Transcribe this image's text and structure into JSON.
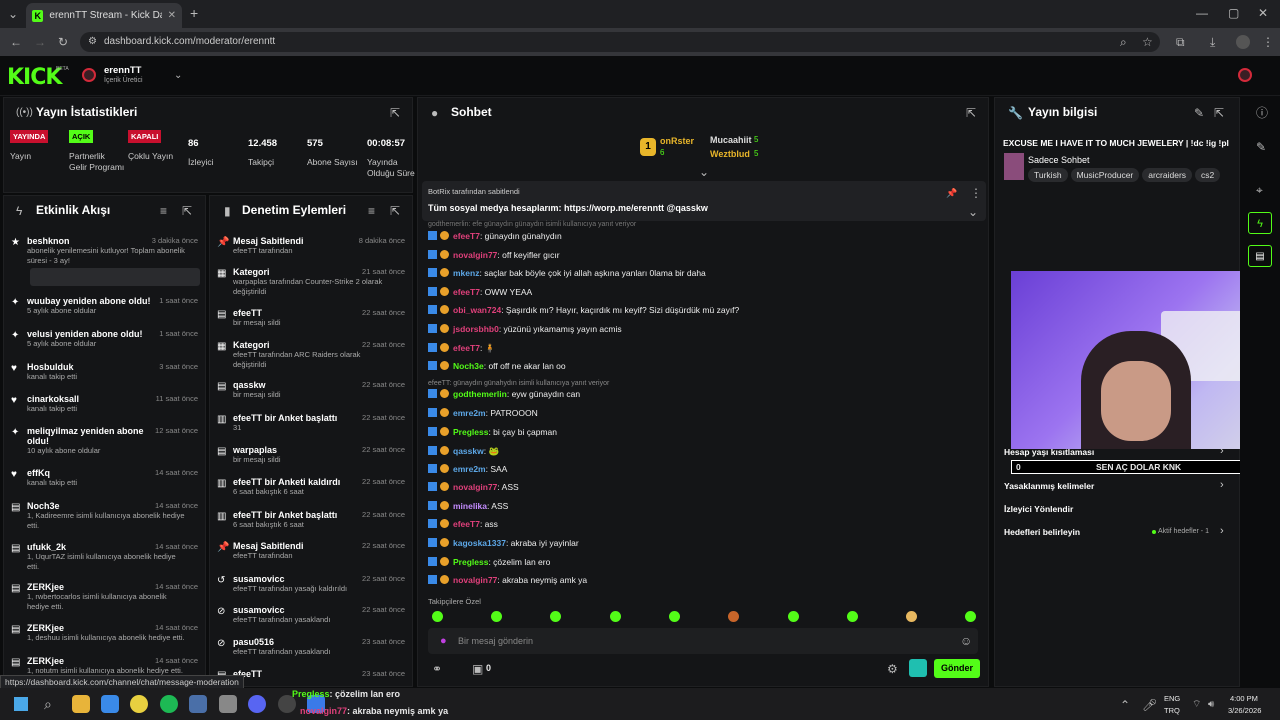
{
  "browser": {
    "tab_title": "erennTT Stream - Kick Dashboard",
    "url": "dashboard.kick.com/moderator/erenntt"
  },
  "header": {
    "logo": "KICK",
    "beta": "BETA",
    "channel": "erennTT",
    "role": "İçerik Üretici"
  },
  "stats": {
    "title": "Yayın İstatistikleri",
    "items": [
      {
        "badge": "YAYINDA",
        "label": "Yayın",
        "kind": "red"
      },
      {
        "badge": "AÇIK",
        "label": "Partnerlik Gelir Programı",
        "kind": "green"
      },
      {
        "badge": "KAPALI",
        "label": "Çoklu Yayın",
        "kind": "red"
      },
      {
        "value": "86",
        "label": "İzleyici"
      },
      {
        "value": "12.458",
        "label": "Takipçi"
      },
      {
        "value": "575",
        "label": "Abone Sayısı"
      },
      {
        "value": "00:08:57",
        "label": "Yayında Olduğu Süre"
      }
    ]
  },
  "activity": {
    "title": "Etkinlik Akışı",
    "items": [
      {
        "icon": "★",
        "name": "beshknon",
        "time": "3 dakika önce",
        "sub": "abonelik yenilemesini kutluyor! Toplam abonelik süresi - 3 ay!"
      },
      {
        "icon": "✦",
        "name": "wuubay yeniden abone oldu!",
        "time": "1 saat önce",
        "sub": "5 aylık abone oldular"
      },
      {
        "icon": "✦",
        "name": "velusi yeniden abone oldu!",
        "time": "1 saat önce",
        "sub": "5 aylık abone oldular"
      },
      {
        "icon": "♥",
        "name": "Hosbulduk",
        "time": "3 saat önce",
        "sub": "kanalı takip etti"
      },
      {
        "icon": "♥",
        "name": "cinarkoksall",
        "time": "11 saat önce",
        "sub": "kanalı takip etti"
      },
      {
        "icon": "✦",
        "name": "meliqyilmaz yeniden abone oldu!",
        "time": "12 saat önce",
        "sub": "10 aylık abone oldular"
      },
      {
        "icon": "♥",
        "name": "effKq",
        "time": "14 saat önce",
        "sub": "kanalı takip etti"
      },
      {
        "icon": "▤",
        "name": "Noch3e",
        "time": "14 saat önce",
        "sub": "1, Kadireemre isimli kullanıcıya abonelik hediye etti."
      },
      {
        "icon": "▤",
        "name": "ufukk_2k",
        "time": "14 saat önce",
        "sub": "1, UqurTAZ isimli kullanıcıya abonelik hediye etti."
      },
      {
        "icon": "▤",
        "name": "ZERKjee",
        "time": "14 saat önce",
        "sub": "1, rwbertocarlos isimli kullanıcıya abonelik hediye etti."
      },
      {
        "icon": "▤",
        "name": "ZERKjee",
        "time": "14 saat önce",
        "sub": "1, deshuu isimli kullanıcıya abonelik hediye etti."
      },
      {
        "icon": "▤",
        "name": "ZERKjee",
        "time": "14 saat önce",
        "sub": "1, notutm isimli kullanıcıya abonelik hediye etti."
      }
    ]
  },
  "mod": {
    "title": "Denetim Eylemleri",
    "items": [
      {
        "icon": "📌",
        "name": "Mesaj Sabitlendi",
        "time": "8 dakika önce",
        "sub": "efeeTT tarafından"
      },
      {
        "icon": "▦",
        "name": "Kategori",
        "time": "21 saat önce",
        "sub": "warpaplas tarafından Counter-Strike 2 olarak değiştirildi"
      },
      {
        "icon": "▤",
        "name": "efeeTT",
        "time": "22 saat önce",
        "sub": "bir mesajı sildi"
      },
      {
        "icon": "▦",
        "name": "Kategori",
        "time": "22 saat önce",
        "sub": "efeeTT tarafından ARC Raiders olarak değiştirildi"
      },
      {
        "icon": "▤",
        "name": "qasskw",
        "time": "22 saat önce",
        "sub": "bir mesajı sildi"
      },
      {
        "icon": "▥",
        "name": "efeeTT bir Anket başlattı",
        "time": "22 saat önce",
        "sub": "31"
      },
      {
        "icon": "▤",
        "name": "warpaplas",
        "time": "22 saat önce",
        "sub": "bir mesajı sildi"
      },
      {
        "icon": "▥",
        "name": "efeeTT bir Anketi kaldırdı",
        "time": "22 saat önce",
        "sub": "6 saat bakıştık 6 saat"
      },
      {
        "icon": "▥",
        "name": "efeeTT bir Anket başlattı",
        "time": "22 saat önce",
        "sub": "6 saat bakıştık 6 saat"
      },
      {
        "icon": "📌",
        "name": "Mesaj Sabitlendi",
        "time": "22 saat önce",
        "sub": "efeeTT tarafından"
      },
      {
        "icon": "↺",
        "name": "susamovicc",
        "time": "22 saat önce",
        "sub": "efeeTT tarafından yasağı kaldırıldı"
      },
      {
        "icon": "⊘",
        "name": "susamovicc",
        "time": "22 saat önce",
        "sub": "efeeTT tarafından yasaklandı"
      },
      {
        "icon": "⊘",
        "name": "pasu0516",
        "time": "23 saat önce",
        "sub": "efeeTT tarafından yasaklandı"
      },
      {
        "icon": "▤",
        "name": "efeeTT",
        "time": "23 saat önce",
        "sub": ""
      }
    ]
  },
  "chat": {
    "title": "Sohbet",
    "top1": {
      "name": "onRster",
      "count": "6"
    },
    "top2": {
      "name": "Mucaahiit",
      "count": "5"
    },
    "top3": {
      "name": "Weztblud",
      "count": "5"
    },
    "pinned_by": "BotRix tarafından sabitlendi",
    "pinned_text": "Tüm sosyal medya hesaplarım: https://worp.me/erenntt @qasskw",
    "reply_hint": "godthemerlin: efe günaydın günaydın isimli kullanıcıya yanıt veriyor",
    "messages": [
      {
        "user": "efeeT7",
        "color": "#e0407b",
        "text": ": günaydın günahydın"
      },
      {
        "user": "novalgin77",
        "color": "#e0407b",
        "text": ": off keyifler gıcır"
      },
      {
        "user": "mkenz",
        "color": "#5da8e8",
        "text": ": saçlar bak böyle çok iyi allah aşkına yanları 0lama bir daha"
      },
      {
        "user": "efeeT7",
        "color": "#e0407b",
        "text": ": OWW YEAA"
      },
      {
        "user": "obi_wan724",
        "color": "#e0407b",
        "text": ": Şaşırdık mı? Hayır, kaçırdık mı keyif? Sizi düşürdük mü zayıf?"
      },
      {
        "user": "jsdorsbhb0",
        "color": "#e0407b",
        "text": ": yüzünü yıkamamış yayın acmis"
      },
      {
        "user": "efeeT7",
        "color": "#e0407b",
        "text": ": 🧍"
      },
      {
        "user": "Noch3e",
        "color": "#53fc18",
        "text": ": off off ne akar lan oo"
      },
      {
        "user": "godthemerlin",
        "color": "#53fc18",
        "text": ": eyw günaydın can"
      },
      {
        "user": "emre2m",
        "color": "#5da8e8",
        "text": ": PATROOON"
      },
      {
        "user": "Pregless",
        "color": "#53fc18",
        "text": ": bi çay bi çapman"
      },
      {
        "user": "qasskw",
        "color": "#5da8e8",
        "text": ": 🐸"
      },
      {
        "user": "emre2m",
        "color": "#5da8e8",
        "text": ": SAA"
      },
      {
        "user": "novalgin77",
        "color": "#e0407b",
        "text": ": ASS"
      },
      {
        "user": "minelika",
        "color": "#c48cff",
        "text": ": ASS"
      },
      {
        "user": "efeeT7",
        "color": "#e0407b",
        "text": ": ass"
      },
      {
        "user": "kagoska1337",
        "color": "#5da8e8",
        "text": ": akraba iyi yayinlar"
      },
      {
        "user": "Pregless",
        "color": "#53fc18",
        "text": ": çözelim lan ero"
      },
      {
        "user": "novalgin77",
        "color": "#e0407b",
        "text": ": akraba neymiş amk ya"
      }
    ],
    "reply_hint2": "efeeTT: günaydın günahydın isimli kullanıcıya yanıt veriyor",
    "followers_only": "Takipçilere Özel",
    "input_placeholder": "Bir mesaj gönderin",
    "send": "Gönder",
    "count0": "0"
  },
  "info": {
    "title": "Yayın bilgisi",
    "stream_title": "EXCUSE ME I HAVE IT TO MUCH JEWELERY | !dc !ig !pl",
    "category": "Sadece Sohbet",
    "tags": [
      "Turkish",
      "MusicProducer",
      "arcraiders",
      "cs2"
    ],
    "rows": [
      "Hesap yaşı kısıtlaması",
      "Yasaklanmış kelimeler",
      "İzleyici Yönlendir",
      "Hedefleri belirleyin"
    ],
    "goal_badge": "Aktif hedefler - 1",
    "goal_title": "SEN AÇ DOLAR KNK",
    "goal_min": "0",
    "goal_max": "10"
  },
  "status_url": "https://dashboard.kick.com/channel/chat/message-moderation",
  "overlay": {
    "line1_user": "Pregless",
    "line1_text": ": çözelim lan ero",
    "line2_user": "novalgin77",
    "line2_text": ": akraba neymiş amk ya"
  },
  "taskbar": {
    "lang": "ENG",
    "lang2": "TRQ",
    "time": "4:00 PM",
    "date": "3/26/2026"
  }
}
